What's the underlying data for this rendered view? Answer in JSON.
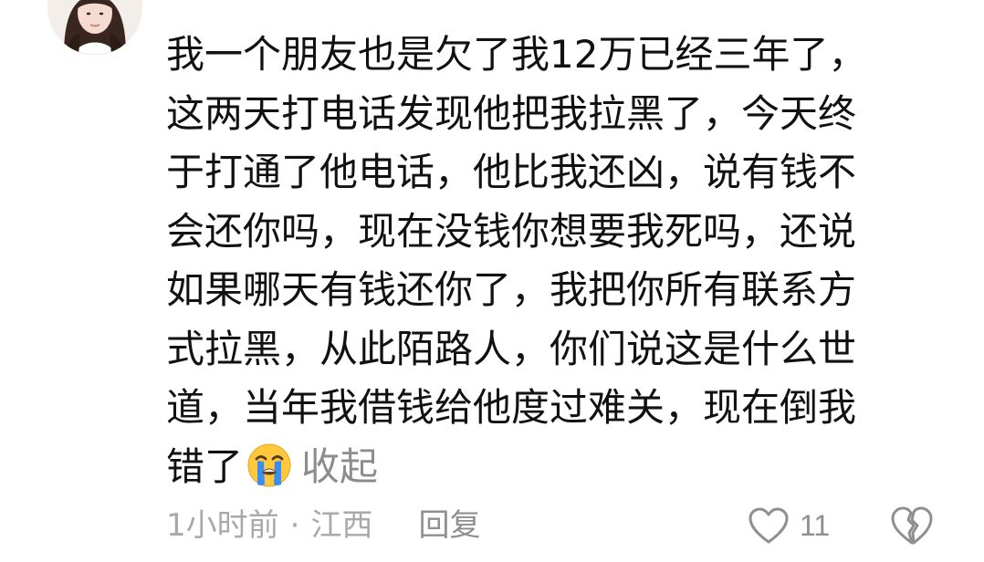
{
  "comment": {
    "text_lines": [
      "我一个朋友也是欠了我12万已经三年了，",
      "这两天打电话发现他把我拉黑了，今天终",
      "于打通了他电话，他比我还凶，说有钱不",
      "会还你吗，现在没钱你想要我死吗，还说",
      "如果哪天有钱还你了，我把你所有联系方",
      "式拉黑，从此陌路人，你们说这是什么世",
      "道，当年我借钱给他度过难关，现在倒我",
      "错了"
    ],
    "emoji_icon": "loudly-crying-face-icon",
    "collapse_label": "收起",
    "time_ago": "1小时前",
    "separator": "·",
    "location": "江西",
    "reply_label": "回复",
    "like_count": "11",
    "like_icon": "heart-outline-icon",
    "dislike_icon": "broken-heart-icon"
  },
  "colors": {
    "text": "#111111",
    "meta": "#a9a9a9",
    "action": "#8f8f8f",
    "emoji_face": "#ffc83d",
    "tears": "#3b8df0"
  }
}
